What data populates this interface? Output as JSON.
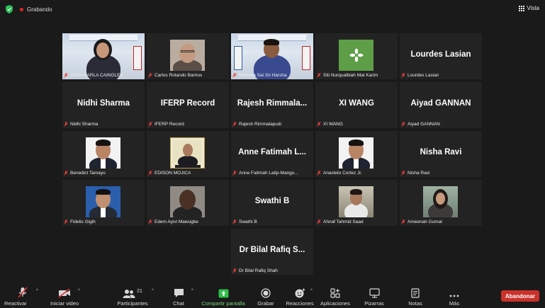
{
  "topbar": {
    "recording_label": "Grabando",
    "view_label": "Vista"
  },
  "colors": {
    "active_speaker_border": "#c8d72a",
    "recording_dot": "#e02828",
    "leave_button": "#c9312b",
    "share_screen": "#2fbf4a"
  },
  "participants": [
    {
      "label": "VERA KARLA CAINGLES",
      "name": "",
      "video": "banner-woman"
    },
    {
      "label": "Carlos Rolando Barrios",
      "name": "",
      "video": "man-glasses"
    },
    {
      "label": "Rankela Sai Sri Harsha",
      "name": "",
      "video": "banner-man"
    },
    {
      "label": "Siti Nurqualbiah Mat Karim",
      "name": "",
      "video": "leaf"
    },
    {
      "label": "Lourdes Lasian",
      "name": "Lourdes Lasian",
      "video": ""
    },
    {
      "label": "Nidhi Sharma",
      "name": "Nidhi Sharma",
      "video": ""
    },
    {
      "label": "IFERP Record",
      "name": "IFERP Record",
      "video": ""
    },
    {
      "label": "Rajesh Rimmalapudi",
      "name": "Rajesh  Rimmala...",
      "video": ""
    },
    {
      "label": "XI WANG",
      "name": "XI WANG",
      "video": ""
    },
    {
      "label": "Aiyad GANNAN",
      "name": "Aiyad GANNAN",
      "video": ""
    },
    {
      "label": "Benedict Tamayo",
      "name": "",
      "video": "portrait-suit"
    },
    {
      "label": "EDISON MOJICA",
      "name": "",
      "video": "certificate-portrait"
    },
    {
      "label": "Anne Fatimah Latip-Mango...",
      "name": "Anne Fatimah  L...",
      "video": ""
    },
    {
      "label": "Anacleto Cortez Jr.",
      "name": "",
      "video": "portrait-suit"
    },
    {
      "label": "Nisha Ravi",
      "name": "Nisha Ravi",
      "video": ""
    },
    {
      "label": "Fidelis Gigih",
      "name": "",
      "video": "portrait-blue"
    },
    {
      "label": "Edem Ayivi Mawugbe",
      "name": "",
      "video": "man-dark"
    },
    {
      "label": "Swathi B",
      "name": "Swathi B",
      "video": ""
    },
    {
      "label": "Ahnaf Tahmid Saad",
      "name": "",
      "video": "man-outdoor"
    },
    {
      "label": "Ameenah Gumal",
      "name": "",
      "video": "woman-outdoor"
    },
    {
      "label": "Dr Bilal Rafiq Shah",
      "name": "Dr Bilal Rafiq S...",
      "video": ""
    }
  ],
  "toolbar": {
    "audio_label": "Reactivar audio",
    "video_label": "Iniciar video",
    "participants_label": "Participantes",
    "participants_count": "21",
    "chat_label": "Chat",
    "share_label": "Compartir pantalla",
    "record_label": "Grabar",
    "reactions_label": "Reacciones",
    "apps_label": "Aplicaciones",
    "whiteboards_label": "Pizarras",
    "notes_label": "Notas",
    "more_label": "Más",
    "leave_label": "Abandonar"
  }
}
